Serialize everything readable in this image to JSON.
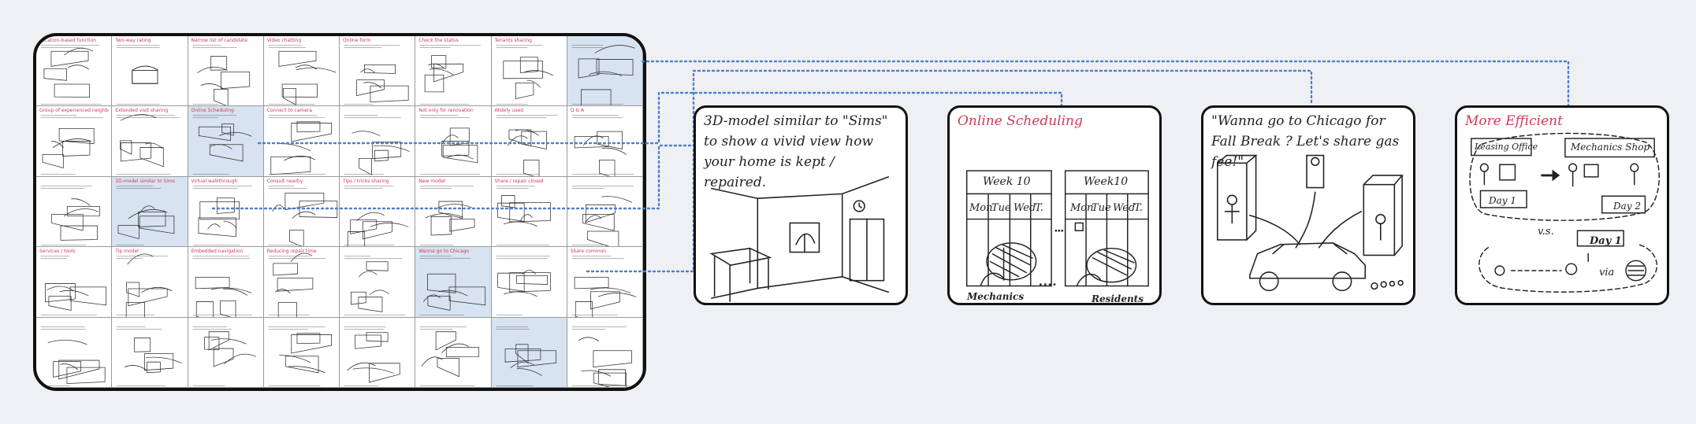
{
  "storyboard_grid": {
    "rows": 5,
    "columns": 8,
    "highlighted_cells": [
      7,
      10,
      17,
      29,
      38
    ],
    "cell_titles": [
      "Location-based function",
      "Two-way rating",
      "Narrow list of candidate",
      "Video chatting",
      "Online form",
      "Check the status",
      "Tenants sharing",
      "",
      "Group of experienced neighbors",
      "Extended visit sharing",
      "Online Scheduling",
      "Connect to camera",
      "",
      "Not only for renovation",
      "Widely used",
      "Q & A",
      "",
      "3D-model similar to Sims",
      "Virtual walkthrough",
      "Consult nearby",
      "Tips / tricks sharing",
      "New model",
      "Share / repair closed",
      "",
      "Services / tools",
      "Tip model",
      "Embedded navigation",
      "Reducing repair time",
      "",
      "Wanna go to Chicago",
      "",
      "Share common",
      "",
      "",
      "",
      "",
      "",
      "",
      "",
      ""
    ]
  },
  "cards": [
    {
      "caption": "3D-model similar to \"Sims\" to show a vivid view how your home is kept / repaired.",
      "caption_color": "#222222"
    },
    {
      "caption": "Online Scheduling",
      "caption_color": "#d23a5a",
      "week_left": "Week 10",
      "week_right": "Week10",
      "days": [
        "Mon",
        "Tue",
        "Wed",
        "T."
      ],
      "label_left": "Mechanics",
      "label_right": "Residents"
    },
    {
      "caption": "\"Wanna go to Chicago for Fall Break ? Let's share gas fee!\"",
      "caption_color": "#222222"
    },
    {
      "caption": "More Efficient",
      "caption_color": "#d23a5a",
      "box_leasing": "Leasing Office",
      "box_mechanics": "Mechanics Shop",
      "day1": "Day 1",
      "day2": "Day 2",
      "vs": "v.s.",
      "day1b": "Day 1",
      "via": "via"
    }
  ],
  "colors": {
    "background": "#eef0f4",
    "highlight": "#d7e3f1",
    "connector": "#4f7fc7",
    "accent_red": "#d23a5a"
  }
}
